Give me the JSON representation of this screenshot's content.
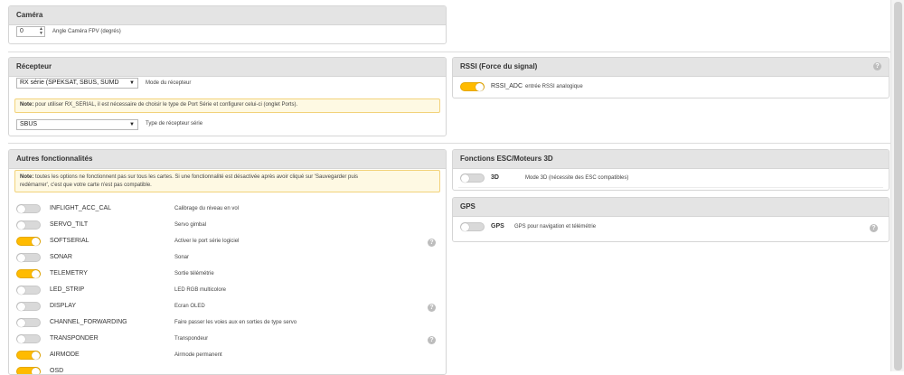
{
  "camera": {
    "title": "Caméra",
    "angle_value": "0",
    "angle_label": "Angle Caméra FPV (degrés)"
  },
  "receiver": {
    "title": "Récepteur",
    "mode_selected": "RX série (SPEKSAT, SBUS, SUMD",
    "mode_label": "Mode du récepteur",
    "note_bold": "Note:",
    "note_text": " pour utiliser RX_SERIAL, il est nécessaire de choisir le type de Port Série et configurer celui-ci (onglet Ports).",
    "type_selected": "SBUS",
    "type_label": "Type de récepteur série"
  },
  "rssi": {
    "title": "RSSI (Force du signal)",
    "name": "RSSI_ADC",
    "desc": "entrée RSSI analogique",
    "enabled": true
  },
  "features": {
    "title": "Autres fonctionnalités",
    "note_bold": "Note:",
    "note_line1": " toutes les options ne fonctionnent pas sur tous les cartes. Si une fonctionnalité est désactivée après avoir cliqué sur 'Sauvegarder puis",
    "note_line2": "redémarrer', c'est que votre carte n'est pas compatible.",
    "items": [
      {
        "name": "INFLIGHT_ACC_CAL",
        "desc": "Calibrage du niveau en vol",
        "enabled": false,
        "help": false
      },
      {
        "name": "SERVO_TILT",
        "desc": "Servo gimbal",
        "enabled": false,
        "help": false
      },
      {
        "name": "SOFTSERIAL",
        "desc": "Activer le port série logiciel",
        "enabled": true,
        "help": true
      },
      {
        "name": "SONAR",
        "desc": "Sonar",
        "enabled": false,
        "help": false
      },
      {
        "name": "TELEMETRY",
        "desc": "Sortie télémétrie",
        "enabled": true,
        "help": false
      },
      {
        "name": "LED_STRIP",
        "desc": "LED RGB multicolore",
        "enabled": false,
        "help": false
      },
      {
        "name": "DISPLAY",
        "desc": "Ecran OLED",
        "enabled": false,
        "help": true
      },
      {
        "name": "CHANNEL_FORWARDING",
        "desc": "Faire passer les voies aux en sorties de type servo",
        "enabled": false,
        "help": false
      },
      {
        "name": "TRANSPONDER",
        "desc": "Transpondeur",
        "enabled": false,
        "help": true
      },
      {
        "name": "AIRMODE",
        "desc": "Airmode permanent",
        "enabled": true,
        "help": false
      },
      {
        "name": "OSD",
        "desc": "",
        "enabled": true,
        "help": false
      }
    ]
  },
  "esc": {
    "title": "Fonctions ESC/Moteurs 3D",
    "name": "3D",
    "desc": "Mode 3D (nécessite des ESC compatibles)",
    "enabled": false
  },
  "gps": {
    "title": "GPS",
    "name": "GPS",
    "desc": "GPS pour navigation et télémétrie",
    "enabled": false
  },
  "help_glyph": "?",
  "colors": {
    "accent": "#ffbb00",
    "header": "#e4e4e4",
    "note_bg": "#fef9e3"
  }
}
